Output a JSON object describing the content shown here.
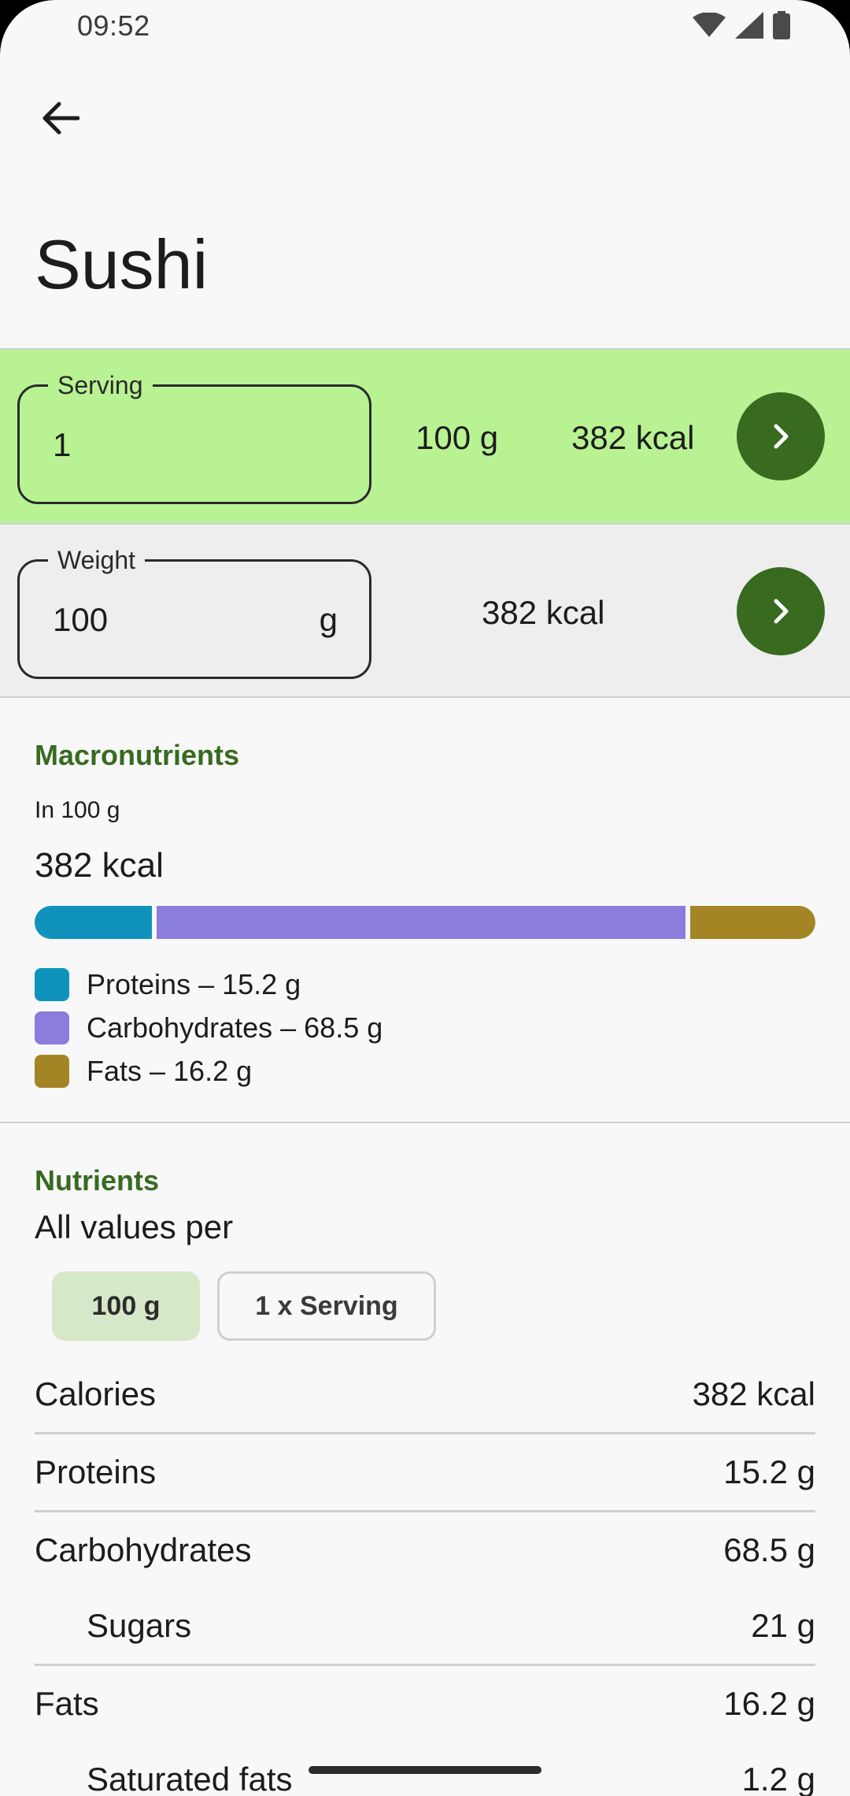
{
  "status": {
    "time": "09:52",
    "icons": [
      "wifi-icon",
      "cell-signal-icon",
      "battery-icon"
    ]
  },
  "header": {
    "title": "Sushi"
  },
  "serving_row": {
    "label": "Serving",
    "value": "1",
    "weight_text": "100 g",
    "kcal_text": "382 kcal"
  },
  "weight_row": {
    "label": "Weight",
    "value": "100",
    "suffix": "g",
    "kcal_text": "382 kcal"
  },
  "macronutrients": {
    "header": "Macronutrients",
    "subtitle": "In 100 g",
    "kcal": "382 kcal",
    "legend": [
      {
        "text": "Proteins – 15.2 g",
        "color": "#0f93bc"
      },
      {
        "text": "Carbohydrates – 68.5 g",
        "color": "#8b7ddc"
      },
      {
        "text": "Fats – 16.2 g",
        "color": "#a48526"
      }
    ],
    "bar_values": [
      15.2,
      68.5,
      16.2
    ]
  },
  "nutrients": {
    "header": "Nutrients",
    "subtitle": "All values per",
    "chips": [
      {
        "label": "100 g",
        "selected": true
      },
      {
        "label": "1 x Serving",
        "selected": false
      }
    ],
    "rows": [
      {
        "name": "Calories",
        "value": "382 kcal"
      },
      {
        "name": "Proteins",
        "value": "15.2 g"
      },
      {
        "name": "Carbohydrates",
        "value": "68.5 g"
      },
      {
        "name": "Sugars",
        "value": "21 g"
      },
      {
        "name": "Fats",
        "value": "16.2 g"
      },
      {
        "name": "Saturated fats",
        "value": "1.2 g"
      }
    ]
  },
  "colors": {
    "accent": "#386a20",
    "serving_row_bg": "#b9f293",
    "weight_row_bg": "#eeeeee"
  }
}
